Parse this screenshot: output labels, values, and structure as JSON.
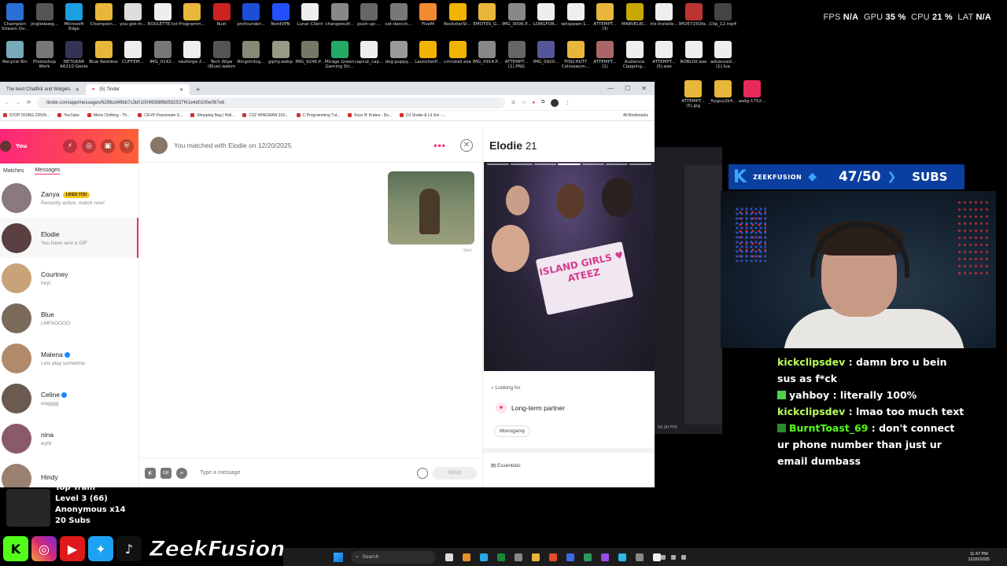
{
  "overlay_stats": {
    "fps_label": "FPS",
    "fps": "N/A",
    "gpu_label": "GPU",
    "gpu": "35 %",
    "cpu_label": "CPU",
    "cpu": "21 %",
    "lat_label": "LAT",
    "lat": "N/A"
  },
  "desktop_icons": [
    {
      "label": "Champion Stream Ov...",
      "color": "#2a6fd6",
      "row": 0
    },
    {
      "label": "jingledawg...",
      "color": "#555",
      "row": 0
    },
    {
      "label": "Microsoft Edge",
      "color": "#1a9fe0",
      "row": 0
    },
    {
      "label": "Champion...",
      "color": "#e8b63a",
      "row": 0
    },
    {
      "label": "you-got-m...",
      "color": "#ddd",
      "row": 0
    },
    {
      "label": "ROULETTE.txt",
      "color": "#eee",
      "row": 0
    },
    {
      "label": "Programm...",
      "color": "#e8b63a",
      "row": 0
    },
    {
      "label": "Rust",
      "color": "#c22",
      "row": 0
    },
    {
      "label": "profounder...",
      "color": "#1a4fd6",
      "row": 0
    },
    {
      "label": "NordVPN",
      "color": "#2350ff",
      "row": 0
    },
    {
      "label": "Lunar Client",
      "color": "#eee",
      "row": 0
    },
    {
      "label": "changeoutf...",
      "color": "#888",
      "row": 0
    },
    {
      "label": "push-up-...",
      "color": "#666",
      "row": 0
    },
    {
      "label": "cat-dancin...",
      "color": "#777",
      "row": 0
    },
    {
      "label": "FiveM",
      "color": "#f28b30",
      "row": 0
    },
    {
      "label": "RockstarSt...",
      "color": "#f0b400",
      "row": 0
    },
    {
      "label": "EMOTES_G...",
      "color": "#e8b63a",
      "row": 0
    },
    {
      "label": "IMG_0006.P...",
      "color": "#888",
      "row": 0
    },
    {
      "label": "LONGFOR...",
      "color": "#eee",
      "row": 0
    },
    {
      "label": "setspawn-1...",
      "color": "#eee",
      "row": 0
    },
    {
      "label": "ATTEMPT... (3)",
      "color": "#e8b63a",
      "row": 0
    },
    {
      "label": "MARVELRI...",
      "color": "#c8a800",
      "row": 0
    },
    {
      "label": "iris-Installe...",
      "color": "#eee",
      "row": 0
    },
    {
      "label": "9ff26715Ofa...",
      "color": "#b33",
      "row": 0
    },
    {
      "label": "Clip_12.mp4",
      "color": "#444",
      "row": 0
    },
    {
      "label": "Recycle Bin",
      "color": "#7ab",
      "row": 1
    },
    {
      "label": "Photoshop Work",
      "color": "#777",
      "row": 1
    },
    {
      "label": "NETGEAR A6210 Genie",
      "color": "#335",
      "row": 1
    },
    {
      "label": "Blue Restless",
      "color": "#e8b63a",
      "row": 1
    },
    {
      "label": "CUFFEM...",
      "color": "#eee",
      "row": 1
    },
    {
      "label": "IMG_0142...",
      "color": "#777",
      "row": 1
    },
    {
      "label": "neoforge-2...",
      "color": "#eee",
      "row": 1
    },
    {
      "label": "Tech Wipe (Blue).webm",
      "color": "#555",
      "row": 1
    },
    {
      "label": "Ringstrilog...",
      "color": "#887",
      "row": 1
    },
    {
      "label": "giphy.webp",
      "color": "#998",
      "row": 1
    },
    {
      "label": "IMG_9246.P...",
      "color": "#776",
      "row": 1
    },
    {
      "label": "Mirage Green Gaming Str...",
      "color": "#2a6",
      "row": 1
    },
    {
      "label": "capcut_cap...",
      "color": "#eee",
      "row": 1
    },
    {
      "label": "dog-puppy...",
      "color": "#999",
      "row": 1
    },
    {
      "label": "LauncherP...",
      "color": "#f0b400",
      "row": 1
    },
    {
      "label": "uninstall.exe",
      "color": "#f0b400",
      "row": 1
    },
    {
      "label": "IMG_0914.P...",
      "color": "#888",
      "row": 1
    },
    {
      "label": "ATTEMPT... (1).PNG",
      "color": "#666",
      "row": 1
    },
    {
      "label": "IMG_0920...",
      "color": "#559",
      "row": 1
    },
    {
      "label": "THSCHUTT Colosseum...",
      "color": "#e8b63a",
      "row": 1
    },
    {
      "label": "ATTEMPT... (1)",
      "color": "#a66",
      "row": 1
    },
    {
      "label": "Audience Clapping...",
      "color": "#eee",
      "row": 1
    },
    {
      "label": "ATTEMPT... (5).exe",
      "color": "#eee",
      "row": 1
    },
    {
      "label": "ROBLOX.exe",
      "color": "#eee",
      "row": 1
    },
    {
      "label": "advanced... (1).lua",
      "color": "#eee",
      "row": 1
    }
  ],
  "desktop_icons_right": [
    {
      "label": "ATTEMPT... (5).jpg",
      "color": "#e8b63a"
    },
    {
      "label": "_ftyguy2k4...",
      "color": "#e8b63a"
    },
    {
      "label": "asdg-1752...",
      "color": "#e82a5a"
    }
  ],
  "browser": {
    "tabs": [
      {
        "title": "The best ChatBot and Widgets",
        "active": false
      },
      {
        "title": "(5) Tinder",
        "active": true
      }
    ],
    "new_tab": "+",
    "url": "tinder.com/app/messages/6296cd48bb7c3b010049368f66592537f41e4d0100e067e6",
    "bookmarks": [
      "STOP DOING CRUN...",
      "YouTube",
      "Mens Clothing - Th...",
      "CEV® Passionate S...",
      "Shopping Bag | Holl...",
      "CS2 WINGMAN 2X2...",
      "C Programming Tut...",
      "Keys N' Krates - Du...",
      "DJ Snake & Lil Jon -..."
    ],
    "all_bookmarks": "All Bookmarks"
  },
  "tinder": {
    "you_label": "You",
    "tabs": [
      "Matches",
      "Messages"
    ],
    "conversations": [
      {
        "name": "Zanya",
        "badge": "LIKES YOU",
        "preview": "Recently active, match now!",
        "verified": false,
        "color": "#8a7a80"
      },
      {
        "name": "Elodie",
        "badge": "",
        "preview": "You have sent a GIF",
        "verified": false,
        "color": "#5a4040",
        "selected": true
      },
      {
        "name": "Courtney",
        "badge": "",
        "preview": "hey!",
        "verified": false,
        "color": "#c9a27a"
      },
      {
        "name": "Blue",
        "badge": "",
        "preview": "LMFAOOOO",
        "verified": false,
        "color": "#7a6a5a"
      },
      {
        "name": "Malena",
        "badge": "",
        "preview": "Lets play sometime",
        "verified": true,
        "color": "#b08a6a"
      },
      {
        "name": "Celine",
        "badge": "",
        "preview": "wsgggg",
        "verified": true,
        "color": "#6a5a50"
      },
      {
        "name": "nina",
        "badge": "",
        "preview": "wyfd",
        "verified": false,
        "color": "#8a5a6a"
      },
      {
        "name": "Hindy",
        "badge": "",
        "preview": "",
        "verified": false,
        "color": "#9a8070"
      }
    ],
    "chat": {
      "header": "You matched with Elodie on 12/20/2025",
      "sent_label": "Sent",
      "input_placeholder": "Type a message",
      "gif_label": "GIF",
      "send_label": "SEND"
    },
    "profile": {
      "name": "Elodie",
      "age": "21",
      "sign_text": "ISLAND GIRLS ♥ ATEEZ",
      "looking_for_label": "Looking for",
      "looking_for_value": "Long-term partner",
      "tag": "Monogamy",
      "essentials_label": "Essentials"
    }
  },
  "obs_mini": {
    "fps": "60.00 FPS"
  },
  "stream": {
    "subs_brand": "ZEEKFUSION",
    "subs_count": "47/50",
    "subs_label": "SUBS",
    "chat": [
      {
        "user": "kickclipsdev",
        "color": "#b9ff5a",
        "emote": "",
        "text": "damn bro u bein sus as f*ck"
      },
      {
        "user": "yahboy",
        "color": "#ffffff",
        "emote": "#4cd14c",
        "text": "literally 100%"
      },
      {
        "user": "kickclipsdev",
        "color": "#b9ff5a",
        "emote": "",
        "text": "lmao too much text"
      },
      {
        "user": "BurntToast_69",
        "color": "#53fc18",
        "emote": "#2a8a2a",
        "text": "don't connect ur phone number than just ur email dumbass"
      }
    ],
    "train": {
      "title": "Top Train",
      "level": "Level 3",
      "level_count": "(66)",
      "anon": "Anonymous x14",
      "subs": "20 Subs"
    },
    "handle": "ZeekFusion"
  },
  "taskbar": {
    "search_placeholder": "Search",
    "time": "11:47 PM",
    "date": "12/20/2025",
    "app_colors": [
      "#ddd",
      "#e88f2a",
      "#2aa8e8",
      "#1a8a3a",
      "#888",
      "#e8b63a",
      "#e84a2a",
      "#3a6ae8",
      "#2a9a5a",
      "#9a4ae8",
      "#2ab8e8",
      "#888",
      "#eee"
    ]
  }
}
